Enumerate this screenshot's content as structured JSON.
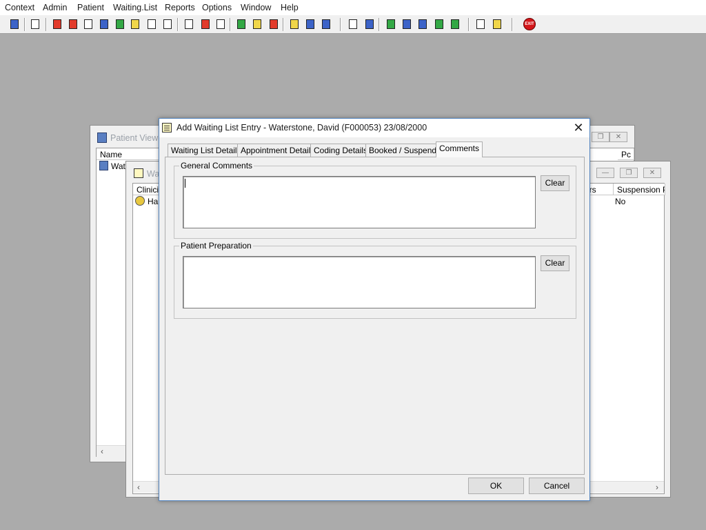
{
  "menubar": [
    "Context",
    "Admin",
    "Patient",
    "Waiting.List",
    "Reports",
    "Options",
    "Window",
    "Help"
  ],
  "toolbar": {
    "exit_label": "EXIT"
  },
  "patient_view": {
    "title": "Patient View",
    "columns": [
      "Name",
      "Pc"
    ],
    "row_name": "Wate",
    "scroll_left": "‹"
  },
  "waiting_window": {
    "title": "Wa",
    "columns": [
      "Clinicia",
      "ers",
      "Suspension Pe"
    ],
    "row_clinician": "Hal",
    "row_suspension": "No",
    "scroll_left": "‹",
    "scroll_right": "›"
  },
  "dialog": {
    "title": "Add Waiting List Entry - Waterstone, David (F000053) 23/08/2000",
    "close": "✕",
    "tabs": [
      "Waiting List Details",
      "Appointment Details",
      "Coding Details",
      "Booked / Suspend",
      "Comments"
    ],
    "active_tab": "Comments",
    "general_comments": {
      "label": "General Comments",
      "value": "",
      "clear": "Clear"
    },
    "patient_preparation": {
      "label": "Patient Preparation",
      "value": "",
      "clear": "Clear"
    },
    "ok": "OK",
    "cancel": "Cancel"
  }
}
